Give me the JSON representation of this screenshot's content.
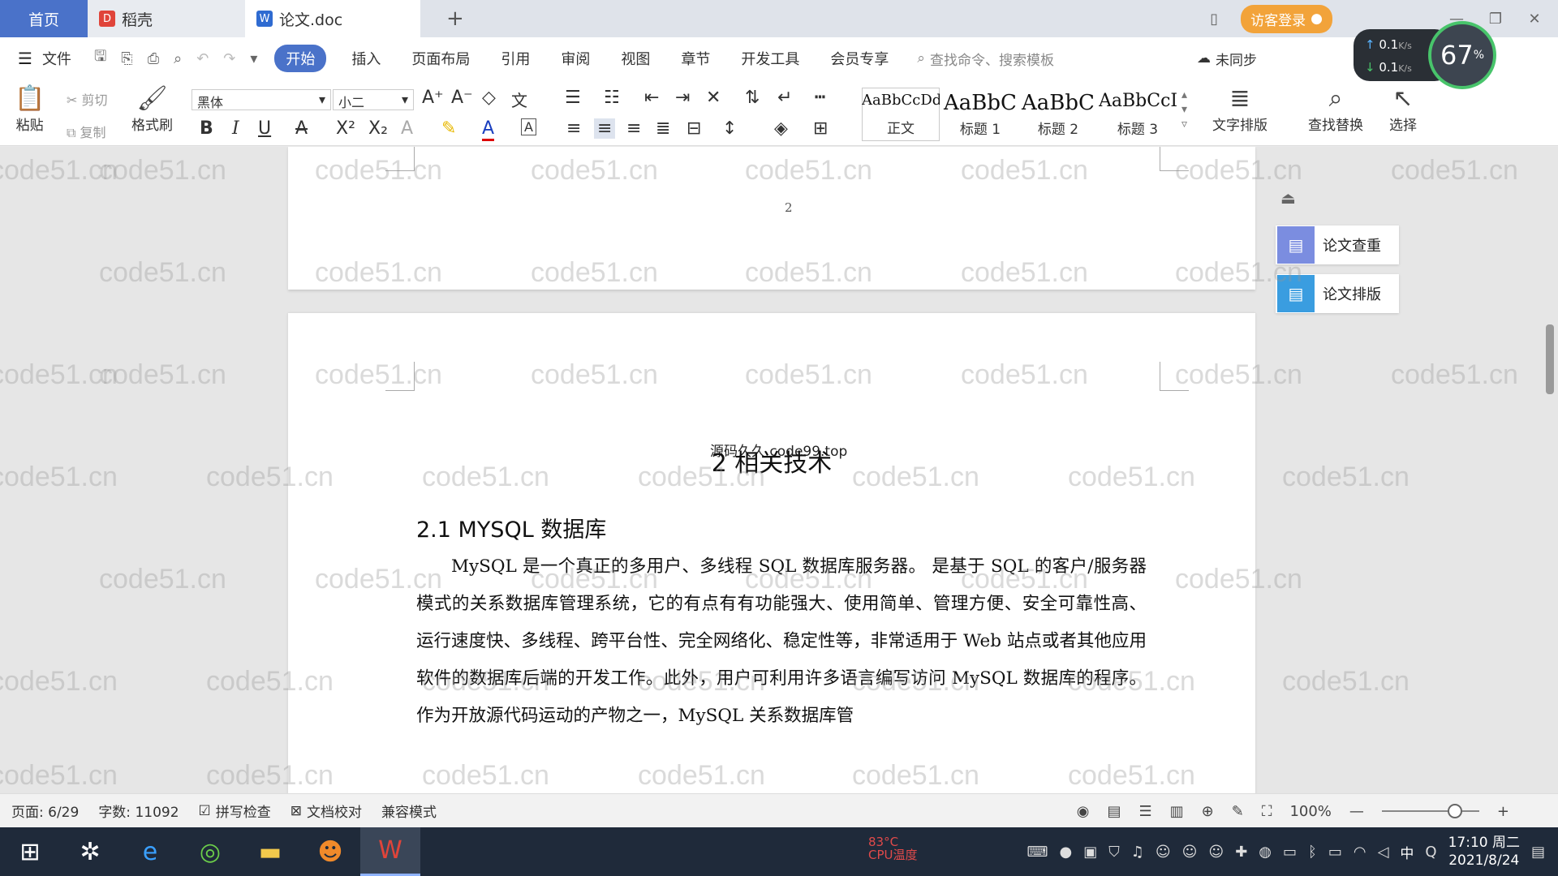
{
  "tabs": {
    "home": "首页",
    "daoke": "稻壳",
    "doc": "论文.doc"
  },
  "header": {
    "visitor_login": "访客登录"
  },
  "menu": {
    "file": "文件",
    "items": [
      "开始",
      "插入",
      "页面布局",
      "引用",
      "审阅",
      "视图",
      "章节",
      "开发工具",
      "会员专享"
    ],
    "search_placeholder": "查找命令、搜索模板",
    "sync": "未同步"
  },
  "speed_widget": {
    "upload": "0.1",
    "download": "0.1",
    "unit": "K/s",
    "percent": "67",
    "percent_sign": "%"
  },
  "ribbon": {
    "paste": "粘贴",
    "cut": "剪切",
    "copy": "复制",
    "format_painter": "格式刷",
    "font_name": "黑体",
    "font_size": "小二",
    "styles": [
      {
        "sample": "AaBbCcDd",
        "name": "正文"
      },
      {
        "sample": "AaBbC",
        "name": "标题 1"
      },
      {
        "sample": "AaBbC",
        "name": "标题 2"
      },
      {
        "sample": "AaBbCcI",
        "name": "标题 3"
      }
    ],
    "text_layout": "文字排版",
    "find_replace": "查找替换",
    "select": "选择"
  },
  "document": {
    "page_number_prev": "2",
    "overlay_text": "源码久久 code99.top",
    "chapter_title": "2 相关技术",
    "section_title": "2.1 MYSQL 数据库",
    "paragraph": "MySQL 是一个真正的多用户、多线程 SQL 数据库服务器。 是基于 SQL 的客户/服务器模式的关系数据库管理系统，它的有点有有功能强大、使用简单、管理方便、安全可靠性高、运行速度快、多线程、跨平台性、完全网络化、稳定性等，非常适用于 Web 站点或者其他应用软件的数据库后端的开发工作。此外，用户可利用许多语言编写访问 MySQL 数据库的程序。作为开放源代码运动的产物之一，MySQL 关系数据库管"
  },
  "sidebar": {
    "paper_check": "论文查重",
    "paper_layout": "论文排版"
  },
  "watermark": "code51.cn",
  "status": {
    "page": "页面: 6/29",
    "words": "字数: 11092",
    "spell_check": "拼写检查",
    "doc_proof": "文档校对",
    "compat_mode": "兼容模式",
    "zoom": "100%",
    "zoom_fraction": 0.75
  },
  "taskbar": {
    "cpu_temp": "83°C",
    "cpu_label": "CPU温度",
    "ime": "中",
    "time": "17:10 周二",
    "date": "2021/8/24"
  },
  "colors": {
    "accent": "#4a72c9",
    "visitor": "#f2a33a",
    "gauge_ring": "#48c46b",
    "taskbar": "#1f2a3a"
  }
}
